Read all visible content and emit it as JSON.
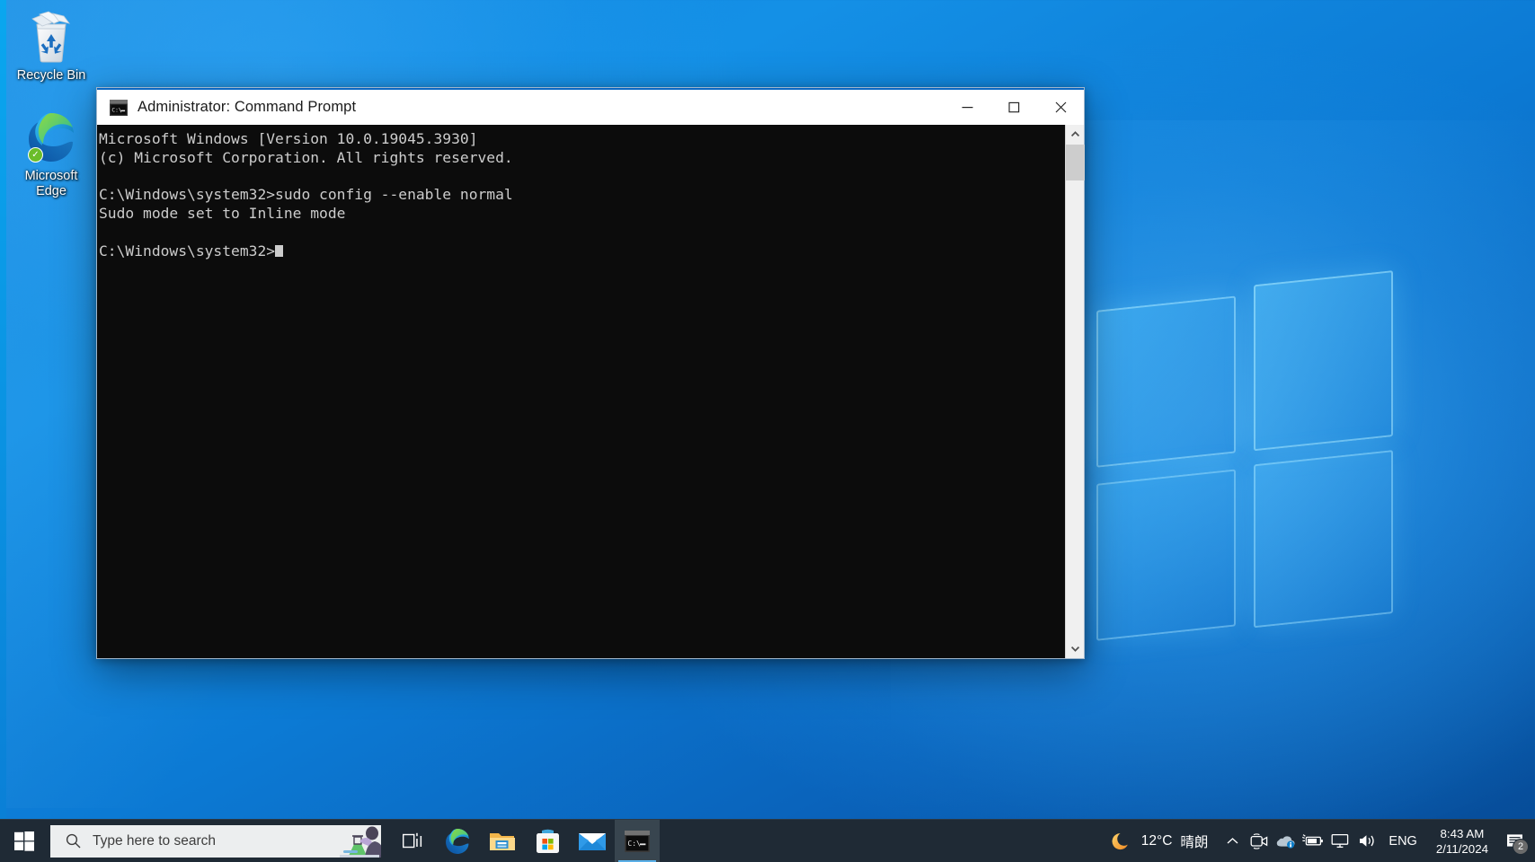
{
  "desktop": {
    "icons": [
      {
        "label": "Recycle Bin",
        "icon": "recycle-bin-icon"
      },
      {
        "label": "Microsoft Edge",
        "label_line1": "Microsoft",
        "label_line2": "Edge",
        "icon": "microsoft-edge-icon",
        "badge": "sync-check"
      }
    ]
  },
  "window": {
    "title": "Administrator: Command Prompt",
    "icon": "command-prompt-icon",
    "controls": {
      "minimize": "Minimize",
      "maximize": "Maximize",
      "close": "Close"
    },
    "console": {
      "lines": [
        "Microsoft Windows [Version 10.0.19045.3930]",
        "(c) Microsoft Corporation. All rights reserved.",
        "",
        "C:\\Windows\\system32>sudo config --enable normal",
        "Sudo mode set to Inline mode",
        "",
        "C:\\Windows\\system32>"
      ],
      "prompt": "C:\\Windows\\system32>",
      "background": "#0c0c0c",
      "foreground": "#cccccc"
    },
    "scrollbar": {
      "up_arrow": "chevron-up-icon",
      "down_arrow": "chevron-down-icon"
    }
  },
  "taskbar": {
    "start": "Start",
    "search": {
      "placeholder": "Type here to search",
      "icon": "search-icon"
    },
    "buttons": [
      {
        "name": "task-view",
        "label": "Task View",
        "icon": "task-view-icon"
      },
      {
        "name": "microsoft-edge",
        "label": "Microsoft Edge",
        "icon": "microsoft-edge-icon"
      },
      {
        "name": "file-explorer",
        "label": "File Explorer",
        "icon": "file-explorer-icon"
      },
      {
        "name": "microsoft-store",
        "label": "Microsoft Store",
        "icon": "microsoft-store-icon"
      },
      {
        "name": "mail",
        "label": "Mail",
        "icon": "mail-icon"
      },
      {
        "name": "command-prompt",
        "label": "Administrator: Command Prompt",
        "icon": "command-prompt-icon",
        "active": true
      }
    ],
    "tray": {
      "weather": {
        "icon": "moon-icon",
        "temperature": "12°C",
        "description": "晴朗"
      },
      "overflow": "chevron-up-icon",
      "icons": [
        {
          "name": "camera-icon",
          "label": "Camera"
        },
        {
          "name": "onedrive-icon",
          "label": "OneDrive"
        },
        {
          "name": "battery-icon",
          "label": "Battery"
        },
        {
          "name": "network-icon",
          "label": "Network"
        },
        {
          "name": "volume-icon",
          "label": "Volume"
        }
      ],
      "language": "ENG",
      "clock": {
        "time": "8:43 AM",
        "date": "2/11/2024"
      },
      "notifications": {
        "icon": "notification-icon",
        "count": "2"
      }
    }
  },
  "colors": {
    "accent": "#0b67c2",
    "taskbar": "#1f2a35",
    "console_bg": "#0c0c0c",
    "console_fg": "#cccccc",
    "active_underline": "#5ab0e8"
  }
}
